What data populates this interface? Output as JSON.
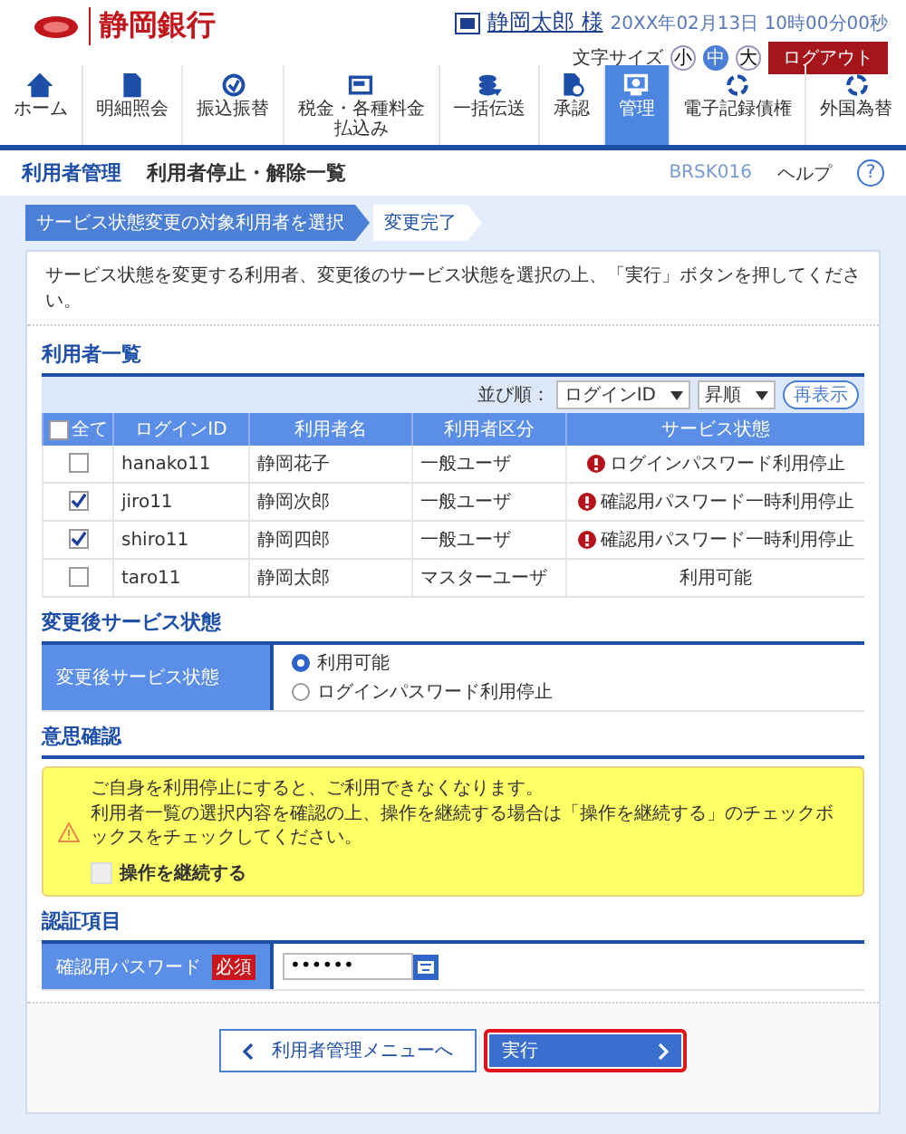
{
  "header": {
    "bank_name": "静岡銀行",
    "user_name": "静岡太郎 様",
    "datetime": "20XX年02月13日 10時00分00秒",
    "font_size_label": "文字サイズ",
    "font_sizes": [
      {
        "label": "小",
        "selected": false
      },
      {
        "label": "中",
        "selected": true
      },
      {
        "label": "大",
        "selected": false
      }
    ],
    "logout": "ログアウト"
  },
  "nav": [
    {
      "kind": "home",
      "label": "ホーム",
      "selected": false
    },
    {
      "kind": "document",
      "label": "明細照会",
      "selected": false
    },
    {
      "kind": "transfer",
      "label": "振込振替",
      "selected": false
    },
    {
      "kind": "bill",
      "label": "税金・各種料金払込み",
      "selected": false
    },
    {
      "kind": "batch",
      "label": "一括伝送",
      "selected": false
    },
    {
      "kind": "approve",
      "label": "承認",
      "selected": false
    },
    {
      "kind": "admin",
      "label": "管理",
      "selected": true
    },
    {
      "kind": "ring",
      "label": "電子記録債権",
      "selected": false
    },
    {
      "kind": "ring",
      "label": "外国為替",
      "selected": false
    }
  ],
  "page": {
    "section": "利用者管理",
    "title": "利用者停止・解除一覧",
    "screen_id": "BRSK016",
    "help": "ヘルプ",
    "help_icon": "?"
  },
  "steps": [
    {
      "label": "サービス状態変更の対象利用者を選択",
      "selected": true
    },
    {
      "label": "変更完了",
      "selected": false
    }
  ],
  "intro": "サービス状態を変更する利用者、変更後のサービス状態を選択の上、「実行」ボタンを押してください。",
  "users": {
    "title": "利用者一覧",
    "sort_label": "並び順：",
    "sort_field": "ログインID",
    "sort_order": "昇順",
    "redisplay": "再表示",
    "select_all_label": "全て",
    "select_all_checked": false,
    "columns": [
      "ログインID",
      "利用者名",
      "利用者区分",
      "サービス状態"
    ],
    "rows": [
      {
        "checked": false,
        "login_id": "hanako11",
        "name": "静岡花子",
        "category": "一般ユーザ",
        "status": "ログインパスワード利用停止",
        "warning": true
      },
      {
        "checked": true,
        "login_id": "jiro11",
        "name": "静岡次郎",
        "category": "一般ユーザ",
        "status": "確認用パスワード一時利用停止",
        "warning": true
      },
      {
        "checked": true,
        "login_id": "shiro11",
        "name": "静岡四郎",
        "category": "一般ユーザ",
        "status": "確認用パスワード一時利用停止",
        "warning": true
      },
      {
        "checked": false,
        "login_id": "taro11",
        "name": "静岡太郎",
        "category": "マスターユーザ",
        "status": "利用可能",
        "warning": false
      }
    ]
  },
  "after_status": {
    "title": "変更後サービス状態",
    "label": "変更後サービス状態",
    "options": [
      {
        "label": "利用可能",
        "selected": true
      },
      {
        "label": "ログインパスワード利用停止",
        "selected": false
      }
    ]
  },
  "confirm": {
    "title": "意思確認",
    "lines": [
      "ご自身を利用停止にすると、ご利用できなくなります。",
      "利用者一覧の選択内容を確認の上、操作を継続する場合は「操作を継続する」のチェックボックスをチェックしてください。"
    ],
    "checkbox_label": "操作を継続する",
    "checked": false
  },
  "auth": {
    "title": "認証項目",
    "label": "確認用パスワード",
    "required": "必須",
    "value": "••••••"
  },
  "buttons": {
    "back": "利用者管理メニューへ",
    "execute": "実行"
  }
}
